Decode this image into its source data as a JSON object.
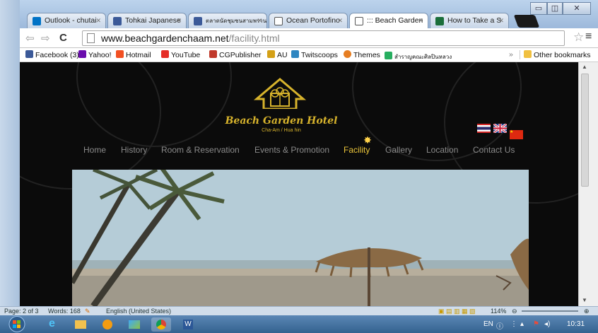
{
  "browser": {
    "tabs": [
      {
        "label": "Outlook - chutai",
        "color": "#0072c6"
      },
      {
        "label": "Tohkai Japanese",
        "color": "#3b5998"
      },
      {
        "label": "ตลาดนัดชุมชนสามพราน",
        "color": "#3b5998"
      },
      {
        "label": "Ocean Portofino",
        "color": "#444444"
      },
      {
        "label": "::: Beach Garden",
        "color": "#444444",
        "active": true
      },
      {
        "label": "How to Take a S",
        "color": "#1a6e3a"
      }
    ],
    "url_host": "www.beachgardenchaam.net",
    "url_path": "/facility.html",
    "bookmarks": [
      {
        "label": "Facebook (3)",
        "color": "#3b5998"
      },
      {
        "label": "Yahoo!",
        "color": "#6a0dad"
      },
      {
        "label": "Hotmail",
        "color": "#f25022"
      },
      {
        "label": "YouTube",
        "color": "#e52d27"
      },
      {
        "label": "CGPublisher",
        "color": "#c0392b"
      },
      {
        "label": "AU",
        "color": "#d4a017"
      },
      {
        "label": "Twitscoops",
        "color": "#2e86c1"
      },
      {
        "label": "Themes",
        "color": "#e67e22"
      },
      {
        "label": "สำราญคณะศิลปินหลวง",
        "color": "#27ae60"
      },
      {
        "label": "Other bookmarks",
        "color": "#f0c040"
      }
    ],
    "more_bookmarks": "»"
  },
  "site": {
    "brand": "Beach Garden Hotel",
    "tagline": "Cha-Am / Hua hin",
    "nav": [
      "Home",
      "History",
      "Room & Reservation",
      "Events & Promotion",
      "Facility",
      "Gallery",
      "Location",
      "Contact Us"
    ],
    "active_nav": "Facility",
    "flags": [
      "Thai",
      "English",
      "Chinese"
    ]
  },
  "word_status": {
    "page": "Page: 2 of 3",
    "words": "Words: 168",
    "language": "English (United States)",
    "zoom": "114%"
  },
  "taskbar": {
    "lang": "EN",
    "time": "10:31"
  },
  "colors": {
    "accent_gold": "#e9c43a",
    "page_bg": "#0b0b0b"
  }
}
